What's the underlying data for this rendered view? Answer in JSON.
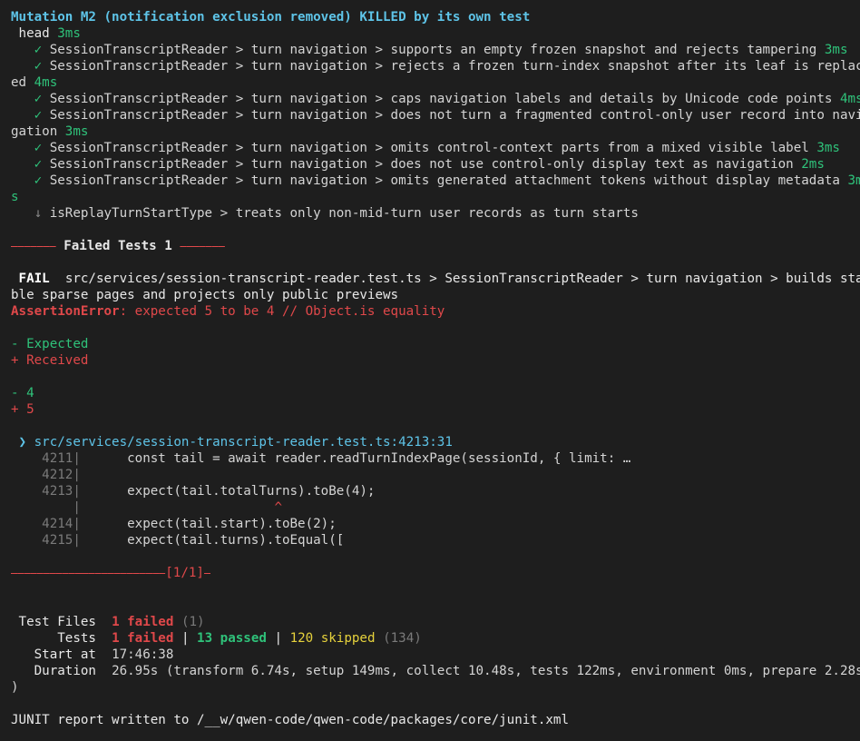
{
  "title": "Mutation M2 (notification exclusion removed) KILLED by its own test",
  "passing": {
    "head_label": " head",
    "head_time": "3ms",
    "check": "✓",
    "skip": "↓",
    "rows": [
      {
        "text": "SessionTranscriptReader > turn navigation > supports an empty frozen snapshot and rejects tampering",
        "time": "3ms"
      },
      {
        "text": "SessionTranscriptReader > turn navigation > rejects a frozen turn-index snapshot after its leaf is replac",
        "wrap": "ed",
        "time": "4ms"
      },
      {
        "text": "SessionTranscriptReader > turn navigation > caps navigation labels and details by Unicode code points",
        "time": "4ms"
      },
      {
        "text": "SessionTranscriptReader > turn navigation > does not turn a fragmented control-only user record into navi",
        "wrap": "gation",
        "time": "3ms"
      },
      {
        "text": "SessionTranscriptReader > turn navigation > omits control-context parts from a mixed visible label",
        "time": "3ms"
      },
      {
        "text": "SessionTranscriptReader > turn navigation > does not use control-only display text as navigation",
        "time": "2ms"
      },
      {
        "text": "SessionTranscriptReader > turn navigation > omits generated attachment tokens without display metadata",
        "time_a": "3m",
        "time_b": "s"
      }
    ],
    "skipped_row": "isReplayTurnStartType > treats only non-mid-turn user records as turn starts"
  },
  "failed_header": {
    "left_rule": "⎯⎯⎯⎯⎯⎯⎯",
    "label": "Failed Tests 1",
    "right_rule": "⎯⎯⎯⎯⎯⎯⎯"
  },
  "failure": {
    "badge": "FAIL",
    "line1": "src/services/session-transcript-reader.test.ts > SessionTranscriptReader > turn navigation > builds sta",
    "line2": "ble sparse pages and projects only public previews",
    "error_name": "AssertionError",
    "error_msg": ": expected 5 to be 4 // Object.is equality",
    "expected_label": "- Expected",
    "received_label": "+ Received",
    "expected_value": "- 4",
    "received_value": "+ 5"
  },
  "source": {
    "arrow": "❯",
    "location": "src/services/session-transcript-reader.test.ts:4213:31",
    "lines": [
      {
        "num": "4211",
        "code": "      const tail = await reader.readTurnIndexPage(sessionId, { limit: …"
      },
      {
        "num": "4212",
        "code": ""
      },
      {
        "num": "4213",
        "code": "      expect(tail.totalTurns).toBe(4);"
      },
      {
        "caret_gutter": "|",
        "caret": "^"
      },
      {
        "num": "4214",
        "code": "      expect(tail.start).toBe(2);"
      },
      {
        "num": "4215",
        "code": "      expect(tail.turns).toEqual(["
      }
    ],
    "pipe": "|"
  },
  "footer_rule": {
    "rule": "⎯⎯⎯⎯⎯⎯⎯⎯⎯⎯⎯⎯⎯⎯⎯⎯⎯⎯⎯⎯⎯⎯⎯⎯",
    "counter": "[1/1]",
    "tail": "⎯"
  },
  "summary": {
    "files_label": " Test Files",
    "files_failed": "1 failed",
    "files_total": "(1)",
    "tests_label": "      Tests",
    "tests_failed": "1 failed",
    "sep": "|",
    "tests_passed": "13 passed",
    "tests_skipped": "120 skipped",
    "tests_total": "(134)",
    "start_label": "   Start at",
    "start_value": "17:46:38",
    "duration_label": "   Duration",
    "duration_value": "26.95s (transform 6.74s, setup 149ms, collect 10.48s, tests 122ms, environment 0ms, prepare 2.28s",
    "duration_wrap": ")"
  },
  "junit": "JUNIT report written to /__w/qwen-code/qwen-code/packages/core/junit.xml",
  "colors": {
    "background": "#1e1e1e",
    "cyan": "#5ec4e8",
    "green": "#2fc27a",
    "red": "#e0484a",
    "yellow": "#e6d23c"
  }
}
